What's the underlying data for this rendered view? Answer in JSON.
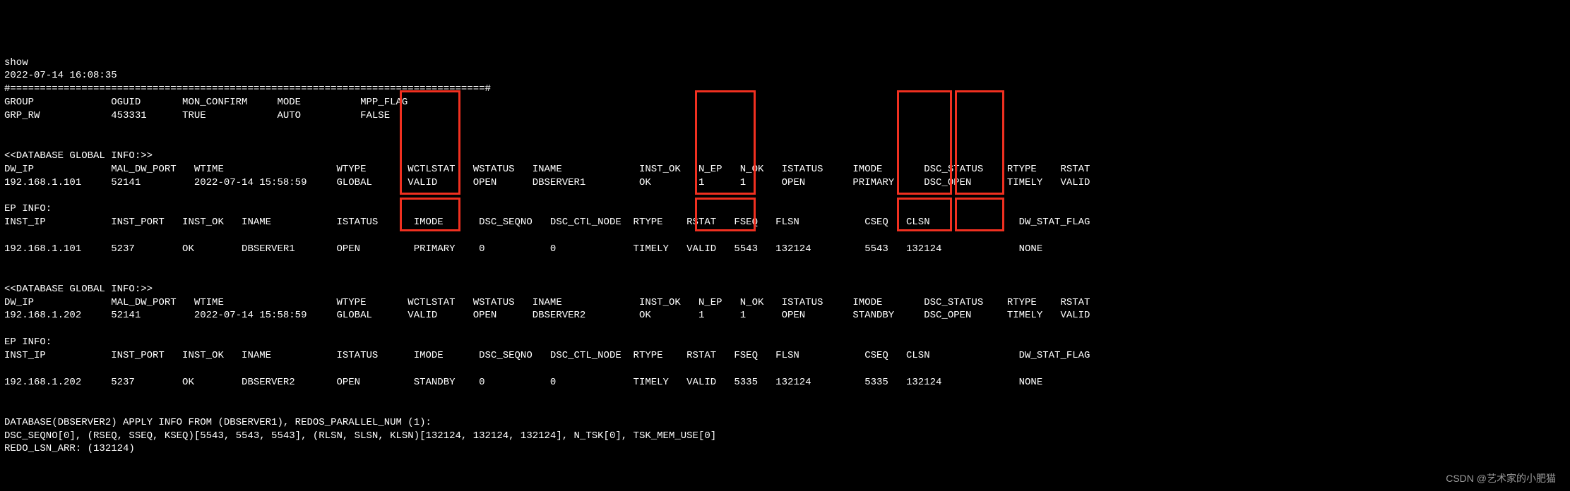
{
  "cmd": "show",
  "timestamp": "2022-07-14 16:08:35",
  "sep": "#================================================================================#",
  "grp_hdr": [
    "GROUP",
    "OGUID",
    "MON_CONFIRM",
    "MODE",
    "MPP_FLAG"
  ],
  "grp_row": [
    "GRP_RW",
    "453331",
    "TRUE",
    "AUTO",
    "FALSE"
  ],
  "gi_title": "<<DATABASE GLOBAL INFO:>>",
  "dw_hdr": [
    "DW_IP",
    "MAL_DW_PORT",
    "WTIME",
    "WTYPE",
    "WCTLSTAT",
    "WSTATUS",
    "INAME",
    "INST_OK",
    "N_EP",
    "N_OK",
    "ISTATUS",
    "IMODE",
    "DSC_STATUS",
    "RTYPE",
    "RSTAT"
  ],
  "dw_row1": [
    "192.168.1.101",
    "52141",
    "2022-07-14 15:58:59",
    "GLOBAL",
    "VALID",
    "OPEN",
    "DBSERVER1",
    "OK",
    "1",
    "1",
    "OPEN",
    "PRIMARY",
    "DSC_OPEN",
    "TIMELY",
    "VALID"
  ],
  "dw_row2": [
    "192.168.1.202",
    "52141",
    "2022-07-14 15:58:59",
    "GLOBAL",
    "VALID",
    "OPEN",
    "DBSERVER2",
    "OK",
    "1",
    "1",
    "OPEN",
    "STANDBY",
    "DSC_OPEN",
    "TIMELY",
    "VALID"
  ],
  "ep_title": "EP INFO:",
  "ep_hdr": [
    "INST_IP",
    "INST_PORT",
    "INST_OK",
    "INAME",
    "ISTATUS",
    "IMODE",
    "DSC_SEQNO",
    "DSC_CTL_NODE",
    "RTYPE",
    "RSTAT",
    "FSEQ",
    "FLSN",
    "CSEQ",
    "CLSN",
    "DW_STAT_FLAG"
  ],
  "ep_row1": [
    "192.168.1.101",
    "5237",
    "OK",
    "DBSERVER1",
    "OPEN",
    "PRIMARY",
    "0",
    "0",
    "TIMELY",
    "VALID",
    "5543",
    "132124",
    "5543",
    "132124",
    "NONE"
  ],
  "ep_row2": [
    "192.168.1.202",
    "5237",
    "OK",
    "DBSERVER2",
    "OPEN",
    "STANDBY",
    "0",
    "0",
    "TIMELY",
    "VALID",
    "5335",
    "132124",
    "5335",
    "132124",
    "NONE"
  ],
  "apply1": "DATABASE(DBSERVER2) APPLY INFO FROM (DBSERVER1), REDOS_PARALLEL_NUM (1):",
  "apply2": "DSC_SEQNO[0], (RSEQ, SSEQ, KSEQ)[5543, 5543, 5543], (RLSN, SLSN, KLSN)[132124, 132124, 132124], N_TSK[0], TSK_MEM_USE[0]",
  "apply3": "REDO_LSN_ARR: (132124)",
  "watermark": "CSDN @艺术家的小肥猫"
}
